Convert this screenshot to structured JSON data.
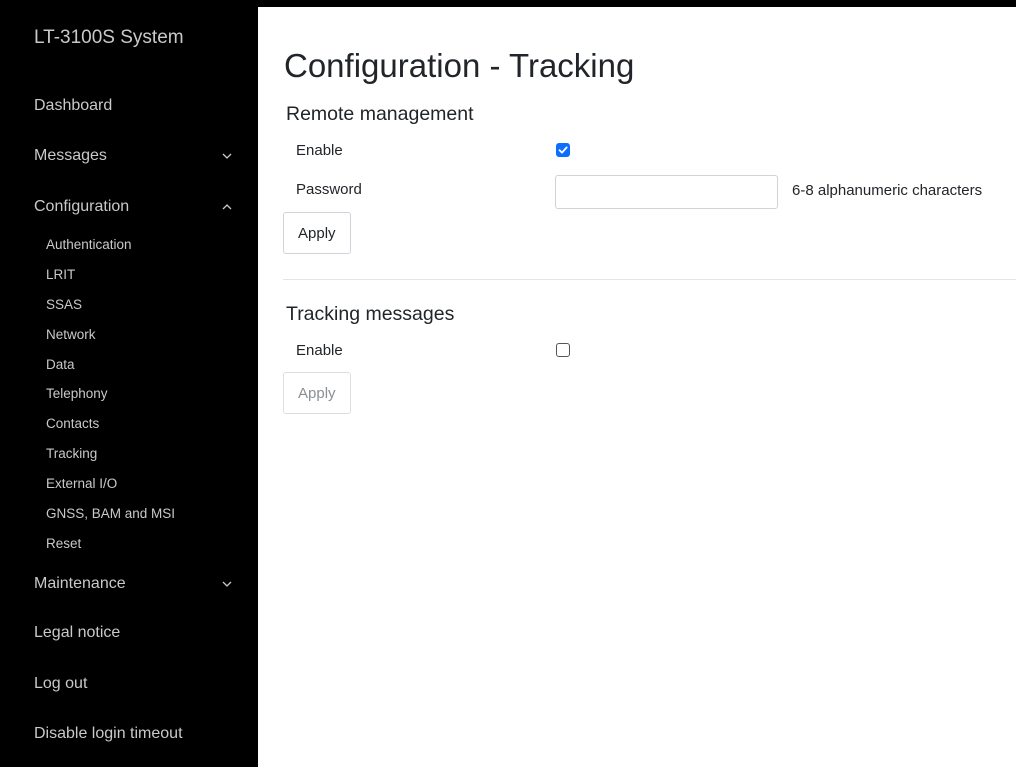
{
  "sidebar": {
    "brand": "LT-3100S System",
    "items": [
      {
        "label": "Dashboard",
        "chevron": null
      },
      {
        "label": "Messages",
        "chevron": "down"
      },
      {
        "label": "Configuration",
        "chevron": "up"
      },
      {
        "label": "Maintenance",
        "chevron": "down"
      },
      {
        "label": "Legal notice",
        "chevron": null
      },
      {
        "label": "Log out",
        "chevron": null
      },
      {
        "label": "Disable login timeout",
        "chevron": null
      }
    ],
    "config_subitems": [
      "Authentication",
      "LRIT",
      "SSAS",
      "Network",
      "Data",
      "Telephony",
      "Contacts",
      "Tracking",
      "External I/O",
      "GNSS, BAM and MSI",
      "Reset"
    ]
  },
  "main": {
    "title": "Configuration - Tracking",
    "remote_management": {
      "heading": "Remote management",
      "enable_label": "Enable",
      "enable_checked": true,
      "password_label": "Password",
      "password_value": "",
      "password_hint": "6-8 alphanumeric characters",
      "apply_label": "Apply"
    },
    "tracking_messages": {
      "heading": "Tracking messages",
      "enable_label": "Enable",
      "enable_checked": false,
      "apply_label": "Apply",
      "apply_disabled": true
    }
  },
  "colors": {
    "sidebar_bg": "#000000",
    "sidebar_text": "#c9c9c9",
    "checkbox_accent": "#0d6efd"
  }
}
